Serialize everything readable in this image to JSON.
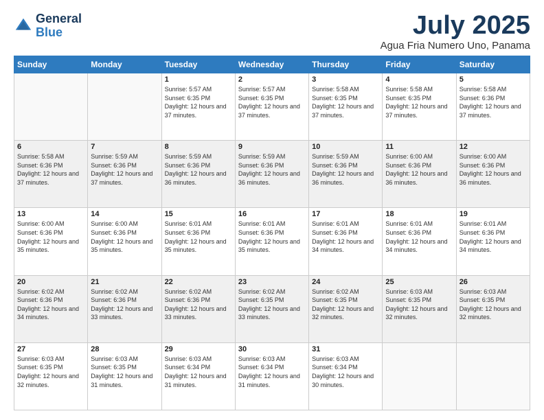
{
  "header": {
    "logo_general": "General",
    "logo_blue": "Blue",
    "title": "July 2025",
    "location": "Agua Fria Numero Uno, Panama"
  },
  "days_of_week": [
    "Sunday",
    "Monday",
    "Tuesday",
    "Wednesday",
    "Thursday",
    "Friday",
    "Saturday"
  ],
  "weeks": [
    [
      {
        "day": "",
        "sunrise": "",
        "sunset": "",
        "daylight": ""
      },
      {
        "day": "",
        "sunrise": "",
        "sunset": "",
        "daylight": ""
      },
      {
        "day": "1",
        "sunrise": "Sunrise: 5:57 AM",
        "sunset": "Sunset: 6:35 PM",
        "daylight": "Daylight: 12 hours and 37 minutes."
      },
      {
        "day": "2",
        "sunrise": "Sunrise: 5:57 AM",
        "sunset": "Sunset: 6:35 PM",
        "daylight": "Daylight: 12 hours and 37 minutes."
      },
      {
        "day": "3",
        "sunrise": "Sunrise: 5:58 AM",
        "sunset": "Sunset: 6:35 PM",
        "daylight": "Daylight: 12 hours and 37 minutes."
      },
      {
        "day": "4",
        "sunrise": "Sunrise: 5:58 AM",
        "sunset": "Sunset: 6:35 PM",
        "daylight": "Daylight: 12 hours and 37 minutes."
      },
      {
        "day": "5",
        "sunrise": "Sunrise: 5:58 AM",
        "sunset": "Sunset: 6:36 PM",
        "daylight": "Daylight: 12 hours and 37 minutes."
      }
    ],
    [
      {
        "day": "6",
        "sunrise": "Sunrise: 5:58 AM",
        "sunset": "Sunset: 6:36 PM",
        "daylight": "Daylight: 12 hours and 37 minutes."
      },
      {
        "day": "7",
        "sunrise": "Sunrise: 5:59 AM",
        "sunset": "Sunset: 6:36 PM",
        "daylight": "Daylight: 12 hours and 37 minutes."
      },
      {
        "day": "8",
        "sunrise": "Sunrise: 5:59 AM",
        "sunset": "Sunset: 6:36 PM",
        "daylight": "Daylight: 12 hours and 36 minutes."
      },
      {
        "day": "9",
        "sunrise": "Sunrise: 5:59 AM",
        "sunset": "Sunset: 6:36 PM",
        "daylight": "Daylight: 12 hours and 36 minutes."
      },
      {
        "day": "10",
        "sunrise": "Sunrise: 5:59 AM",
        "sunset": "Sunset: 6:36 PM",
        "daylight": "Daylight: 12 hours and 36 minutes."
      },
      {
        "day": "11",
        "sunrise": "Sunrise: 6:00 AM",
        "sunset": "Sunset: 6:36 PM",
        "daylight": "Daylight: 12 hours and 36 minutes."
      },
      {
        "day": "12",
        "sunrise": "Sunrise: 6:00 AM",
        "sunset": "Sunset: 6:36 PM",
        "daylight": "Daylight: 12 hours and 36 minutes."
      }
    ],
    [
      {
        "day": "13",
        "sunrise": "Sunrise: 6:00 AM",
        "sunset": "Sunset: 6:36 PM",
        "daylight": "Daylight: 12 hours and 35 minutes."
      },
      {
        "day": "14",
        "sunrise": "Sunrise: 6:00 AM",
        "sunset": "Sunset: 6:36 PM",
        "daylight": "Daylight: 12 hours and 35 minutes."
      },
      {
        "day": "15",
        "sunrise": "Sunrise: 6:01 AM",
        "sunset": "Sunset: 6:36 PM",
        "daylight": "Daylight: 12 hours and 35 minutes."
      },
      {
        "day": "16",
        "sunrise": "Sunrise: 6:01 AM",
        "sunset": "Sunset: 6:36 PM",
        "daylight": "Daylight: 12 hours and 35 minutes."
      },
      {
        "day": "17",
        "sunrise": "Sunrise: 6:01 AM",
        "sunset": "Sunset: 6:36 PM",
        "daylight": "Daylight: 12 hours and 34 minutes."
      },
      {
        "day": "18",
        "sunrise": "Sunrise: 6:01 AM",
        "sunset": "Sunset: 6:36 PM",
        "daylight": "Daylight: 12 hours and 34 minutes."
      },
      {
        "day": "19",
        "sunrise": "Sunrise: 6:01 AM",
        "sunset": "Sunset: 6:36 PM",
        "daylight": "Daylight: 12 hours and 34 minutes."
      }
    ],
    [
      {
        "day": "20",
        "sunrise": "Sunrise: 6:02 AM",
        "sunset": "Sunset: 6:36 PM",
        "daylight": "Daylight: 12 hours and 34 minutes."
      },
      {
        "day": "21",
        "sunrise": "Sunrise: 6:02 AM",
        "sunset": "Sunset: 6:36 PM",
        "daylight": "Daylight: 12 hours and 33 minutes."
      },
      {
        "day": "22",
        "sunrise": "Sunrise: 6:02 AM",
        "sunset": "Sunset: 6:36 PM",
        "daylight": "Daylight: 12 hours and 33 minutes."
      },
      {
        "day": "23",
        "sunrise": "Sunrise: 6:02 AM",
        "sunset": "Sunset: 6:35 PM",
        "daylight": "Daylight: 12 hours and 33 minutes."
      },
      {
        "day": "24",
        "sunrise": "Sunrise: 6:02 AM",
        "sunset": "Sunset: 6:35 PM",
        "daylight": "Daylight: 12 hours and 32 minutes."
      },
      {
        "day": "25",
        "sunrise": "Sunrise: 6:03 AM",
        "sunset": "Sunset: 6:35 PM",
        "daylight": "Daylight: 12 hours and 32 minutes."
      },
      {
        "day": "26",
        "sunrise": "Sunrise: 6:03 AM",
        "sunset": "Sunset: 6:35 PM",
        "daylight": "Daylight: 12 hours and 32 minutes."
      }
    ],
    [
      {
        "day": "27",
        "sunrise": "Sunrise: 6:03 AM",
        "sunset": "Sunset: 6:35 PM",
        "daylight": "Daylight: 12 hours and 32 minutes."
      },
      {
        "day": "28",
        "sunrise": "Sunrise: 6:03 AM",
        "sunset": "Sunset: 6:35 PM",
        "daylight": "Daylight: 12 hours and 31 minutes."
      },
      {
        "day": "29",
        "sunrise": "Sunrise: 6:03 AM",
        "sunset": "Sunset: 6:34 PM",
        "daylight": "Daylight: 12 hours and 31 minutes."
      },
      {
        "day": "30",
        "sunrise": "Sunrise: 6:03 AM",
        "sunset": "Sunset: 6:34 PM",
        "daylight": "Daylight: 12 hours and 31 minutes."
      },
      {
        "day": "31",
        "sunrise": "Sunrise: 6:03 AM",
        "sunset": "Sunset: 6:34 PM",
        "daylight": "Daylight: 12 hours and 30 minutes."
      },
      {
        "day": "",
        "sunrise": "",
        "sunset": "",
        "daylight": ""
      },
      {
        "day": "",
        "sunrise": "",
        "sunset": "",
        "daylight": ""
      }
    ]
  ]
}
